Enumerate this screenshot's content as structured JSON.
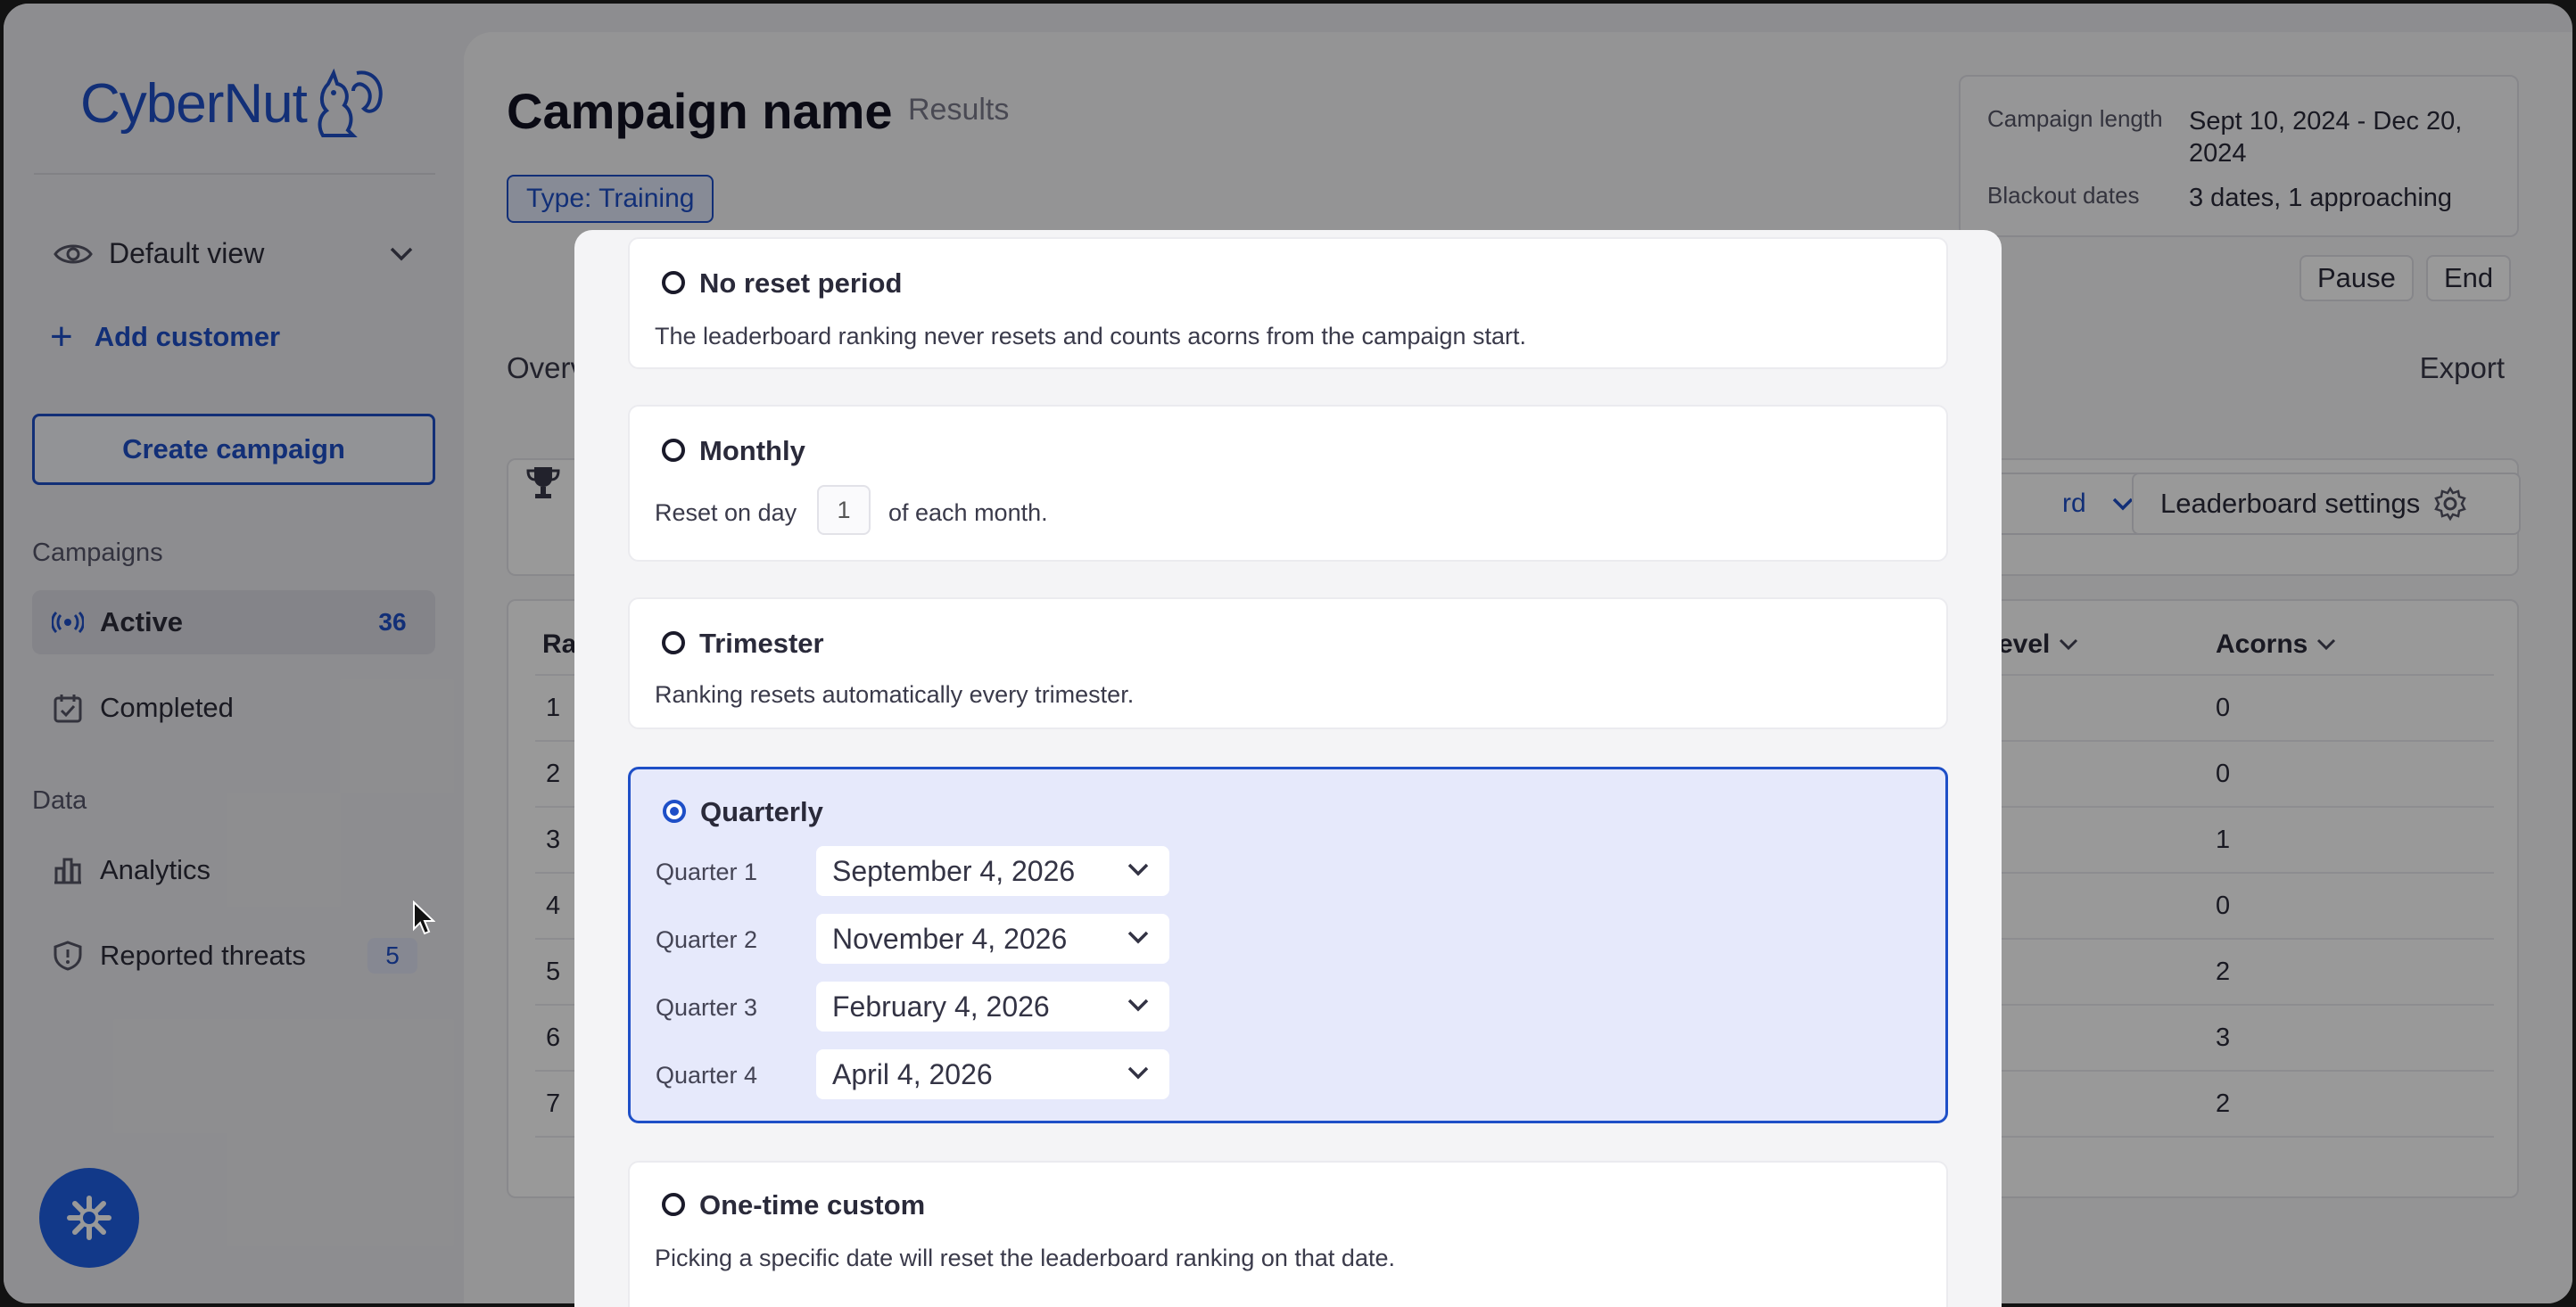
{
  "sidebar": {
    "logo": "CyberNut",
    "view": "Default view",
    "add_customer": "Add customer",
    "create_campaign": "Create campaign",
    "campaigns_title": "Campaigns",
    "active_label": "Active",
    "active_count": "36",
    "completed_label": "Completed",
    "data_title": "Data",
    "analytics_label": "Analytics",
    "reported_label": "Reported threats",
    "reported_count": "5"
  },
  "header": {
    "title": "Campaign name",
    "results": "Results",
    "type_pill": "Type: Training",
    "length_key": "Campaign length",
    "length_val": "Sept 10, 2024 - Dec 20, 2024",
    "blackout_key": "Blackout dates",
    "blackout_val": "3 dates, 1 approaching",
    "pause": "Pause",
    "end": "End",
    "overview_partial": "Overv",
    "export": "Export"
  },
  "toolbar": {
    "filter_partial": "rd",
    "leaderboard_settings": "Leaderboard settings"
  },
  "table": {
    "rank_partial": "Ra",
    "level_partial": "evel",
    "acorns_header": "Acorns",
    "ranks": [
      "1",
      "2",
      "3",
      "4",
      "5",
      "6",
      "7"
    ],
    "acorns": [
      "0",
      "0",
      "1",
      "0",
      "2",
      "3",
      "2"
    ]
  },
  "modal": {
    "no_reset": {
      "title": "No reset period",
      "desc": "The leaderboard ranking never resets and counts acorns from the campaign start."
    },
    "monthly": {
      "title": "Monthly",
      "prefix": "Reset on day",
      "day": "1",
      "suffix": "of each month."
    },
    "trimester": {
      "title": "Trimester",
      "desc": "Ranking resets automatically every trimester."
    },
    "quarterly": {
      "title": "Quarterly",
      "quarters": [
        {
          "label": "Quarter 1",
          "date": "September 4, 2026"
        },
        {
          "label": "Quarter 2",
          "date": "November 4, 2026"
        },
        {
          "label": "Quarter 3",
          "date": "February 4, 2026"
        },
        {
          "label": "Quarter 4",
          "date": "April 4, 2026"
        }
      ]
    },
    "one_time": {
      "title": "One-time custom",
      "desc": "Picking a specific date will reset the leaderboard ranking on that date."
    },
    "selected_option": "Quarterly"
  },
  "colors": {
    "accent": "#1e4fc7",
    "selected_bg": "#e6e9fb",
    "fab": "#1e5fe4"
  }
}
